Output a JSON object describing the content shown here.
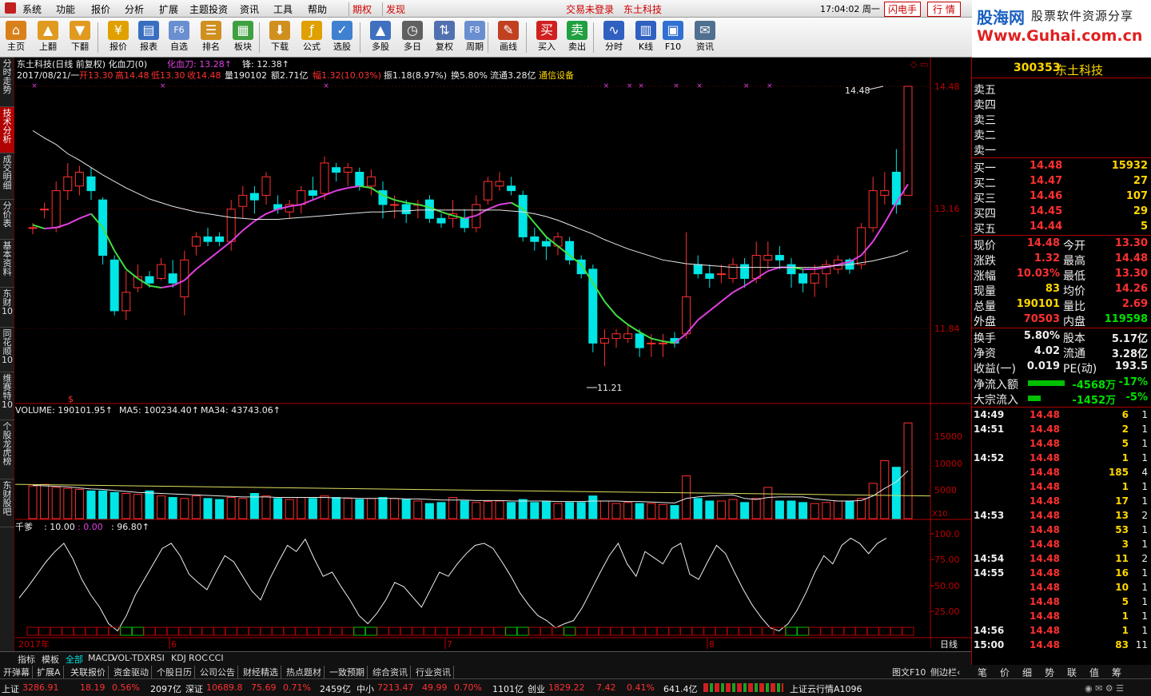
{
  "menu": {
    "items": [
      "系统",
      "功能",
      "报价",
      "分析",
      "扩展",
      "主题投资",
      "资讯",
      "工具",
      "帮助"
    ],
    "tabs": [
      "期权",
      "发现"
    ],
    "login": "交易未登录",
    "stock": "东土科技",
    "time": "17:04:02 周一",
    "buttons": [
      "闪电手",
      "行 情"
    ]
  },
  "logo": {
    "line1": "股海网",
    "line2": "股票软件资源分享",
    "url": "Www.Guhai.com.cn"
  },
  "toolbar": [
    {
      "label": "主页",
      "icon": "home-icon",
      "color": "#d8801a"
    },
    {
      "label": "上翻",
      "icon": "arrow-up-icon",
      "color": "#e09a20"
    },
    {
      "label": "下翻",
      "icon": "arrow-down-icon",
      "color": "#e09a20"
    },
    {
      "label": "报价",
      "icon": "yen-icon",
      "color": "#e0a000"
    },
    {
      "label": "报表",
      "icon": "report-icon",
      "color": "#3a6ec0"
    },
    {
      "label": "自选",
      "icon": "f6-icon",
      "color": "#6a8fd0"
    },
    {
      "label": "排名",
      "icon": "rank-icon",
      "color": "#d09020"
    },
    {
      "label": "板块",
      "icon": "blocks-icon",
      "color": "#40a040"
    },
    {
      "label": "下载",
      "icon": "download-icon",
      "color": "#d09020"
    },
    {
      "label": "公式",
      "icon": "formula-icon",
      "color": "#e0a000"
    },
    {
      "label": "选股",
      "icon": "select-icon",
      "color": "#4080d0"
    },
    {
      "label": "多股",
      "icon": "multi-icon",
      "color": "#4070c0"
    },
    {
      "label": "多日",
      "icon": "clock-icon",
      "color": "#606060"
    },
    {
      "label": "复权",
      "icon": "adjust-icon",
      "color": "#5070b0"
    },
    {
      "label": "周期",
      "icon": "f8-icon",
      "color": "#6a8fd0"
    },
    {
      "label": "画线",
      "icon": "draw-icon",
      "color": "#c04020"
    },
    {
      "label": "买入",
      "icon": "buy-icon",
      "color": "#d02020"
    },
    {
      "label": "卖出",
      "icon": "sell-icon",
      "color": "#20a040"
    },
    {
      "label": "分时",
      "icon": "intraday-icon",
      "color": "#3060c0"
    },
    {
      "label": "K线",
      "icon": "kline-icon",
      "color": "#3060c0"
    },
    {
      "label": "F10",
      "icon": "f10-icon",
      "color": "#3070d0"
    },
    {
      "label": "资讯",
      "icon": "news-icon",
      "color": "#507090"
    }
  ],
  "side_tabs": [
    "分时走势",
    "技术分析",
    "成交明细",
    "分价表",
    "基本资料",
    "东财10",
    "同花顺10",
    "维赛特10",
    "个股龙虎榜",
    "东财股吧"
  ],
  "chart_header": {
    "title": "东土科技(日线 前复权) 化血刀(0)",
    "indicator": "化血刀: 13.28↑",
    "feng": "锋: 12.38↑",
    "info_date": "2017/08/21/一",
    "open": "开13.30",
    "high": "高14.48",
    "low": "低13.30",
    "close": "收14.48",
    "vol": "量190102",
    "amount": "额2.71亿",
    "change": "幅1.32(10.03%)",
    "amp": "振1.18(8.97%)",
    "turnover": "换5.80%",
    "float": "流通3.28亿",
    "sector": "通信设备",
    "max_label": "14.48",
    "min_label": "11.21"
  },
  "price_axis": [
    "14.48",
    "13.16",
    "11.84"
  ],
  "vol_header": {
    "vol": "VOLUME: 190101.95↑",
    "ma5": "MA5: 100234.40↑",
    "ma34": "MA34: 43743.06↑"
  },
  "vol_axis": [
    "15000",
    "10000",
    "5000",
    "X10"
  ],
  "osc_header": {
    "name": "千爹",
    "v1": ": 10.00",
    "v2": ": 0.00",
    "v3": ": 96.80↑"
  },
  "osc_axis": [
    "100.0",
    "75.00",
    "50.00",
    "25.00"
  ],
  "date_axis": {
    "year": "2017年",
    "m6": "6",
    "m7": "7",
    "m8": "8",
    "period": "日线"
  },
  "chart_data": {
    "type": "candlestick",
    "ylim": [
      11.21,
      14.48
    ],
    "candles": [
      [
        12.95,
        12.95,
        13.0,
        12.88
      ],
      [
        13.15,
        13.15,
        13.22,
        13.05
      ],
      [
        12.95,
        13.35,
        13.45,
        12.9
      ],
      [
        13.35,
        13.5,
        13.65,
        13.25
      ],
      [
        13.4,
        13.55,
        13.62,
        13.3
      ],
      [
        13.5,
        13.35,
        13.6,
        13.25
      ],
      [
        13.25,
        12.65,
        13.28,
        12.55
      ],
      [
        12.6,
        12.05,
        12.65,
        12.0
      ],
      [
        12.05,
        12.25,
        12.48,
        11.95
      ],
      [
        12.3,
        12.42,
        12.55,
        12.25
      ],
      [
        12.42,
        12.35,
        12.48,
        12.3
      ],
      [
        12.4,
        12.55,
        12.62,
        12.38
      ],
      [
        12.45,
        12.35,
        12.6,
        12.3
      ],
      [
        12.2,
        12.6,
        12.7,
        12.0
      ],
      [
        12.75,
        12.85,
        12.9,
        12.65
      ],
      [
        12.85,
        12.8,
        12.95,
        12.75
      ],
      [
        12.85,
        12.8,
        12.9,
        12.75
      ],
      [
        12.8,
        13.15,
        13.25,
        12.7
      ],
      [
        13.18,
        13.3,
        13.4,
        13.05
      ],
      [
        13.32,
        13.25,
        13.4,
        13.1
      ],
      [
        13.3,
        13.5,
        13.55,
        13.2
      ],
      [
        13.2,
        13.15,
        13.3,
        13.1
      ],
      [
        13.12,
        13.2,
        13.25,
        13.05
      ],
      [
        13.2,
        13.35,
        13.4,
        13.1
      ],
      [
        13.35,
        13.3,
        13.5,
        13.25
      ],
      [
        13.32,
        13.65,
        13.72,
        13.25
      ],
      [
        13.6,
        13.55,
        13.65,
        13.45
      ],
      [
        13.55,
        13.6,
        13.65,
        13.4
      ],
      [
        13.55,
        13.4,
        13.6,
        13.35
      ],
      [
        13.4,
        13.5,
        13.58,
        13.3
      ],
      [
        13.35,
        13.2,
        13.45,
        13.05
      ],
      [
        13.2,
        13.2,
        13.3,
        13.05
      ],
      [
        13.2,
        13.1,
        13.25,
        13.0
      ],
      [
        13.2,
        13.2,
        13.25,
        13.05
      ],
      [
        13.25,
        13.05,
        13.3,
        13.0
      ],
      [
        13.05,
        13.0,
        13.1,
        12.95
      ],
      [
        13.05,
        13.1,
        13.25,
        12.95
      ],
      [
        13.05,
        12.95,
        13.15,
        12.9
      ],
      [
        12.95,
        13.2,
        13.3,
        12.9
      ],
      [
        13.25,
        13.45,
        13.5,
        13.2
      ],
      [
        13.4,
        13.45,
        13.55,
        13.35
      ],
      [
        13.4,
        13.35,
        13.5,
        13.3
      ],
      [
        13.3,
        12.85,
        13.35,
        12.8
      ],
      [
        12.85,
        12.8,
        12.95,
        12.7
      ],
      [
        12.8,
        12.75,
        12.85,
        12.6
      ],
      [
        12.75,
        12.85,
        12.9,
        12.65
      ],
      [
        12.8,
        12.6,
        12.85,
        12.55
      ],
      [
        12.6,
        12.45,
        12.65,
        12.4
      ],
      [
        12.5,
        11.7,
        12.55,
        11.6
      ],
      [
        11.7,
        11.75,
        11.85,
        11.45
      ],
      [
        11.75,
        11.8,
        11.85,
        11.65
      ],
      [
        11.75,
        11.8,
        11.9,
        11.7
      ],
      [
        11.8,
        11.65,
        11.85,
        11.55
      ],
      [
        11.7,
        11.7,
        11.8,
        11.55
      ],
      [
        11.7,
        11.7,
        11.8,
        11.55
      ],
      [
        11.75,
        11.7,
        11.82,
        11.65
      ],
      [
        11.8,
        12.2,
        12.9,
        11.75
      ],
      [
        12.55,
        12.45,
        12.65,
        12.4
      ],
      [
        12.45,
        12.4,
        12.55,
        12.3
      ],
      [
        12.45,
        12.45,
        12.55,
        12.35
      ],
      [
        12.4,
        12.55,
        12.62,
        12.35
      ],
      [
        12.55,
        12.4,
        12.62,
        12.3
      ],
      [
        12.4,
        12.65,
        12.8,
        12.35
      ],
      [
        12.6,
        12.65,
        12.8,
        12.5
      ],
      [
        12.65,
        12.6,
        12.75,
        12.5
      ],
      [
        12.55,
        12.45,
        12.62,
        12.3
      ],
      [
        12.45,
        12.35,
        12.5,
        12.25
      ],
      [
        12.35,
        12.45,
        12.55,
        12.2
      ],
      [
        12.45,
        12.55,
        12.6,
        12.3
      ],
      [
        12.5,
        12.6,
        12.65,
        12.45
      ],
      [
        12.6,
        12.5,
        12.62,
        12.45
      ],
      [
        12.55,
        12.95,
        13.0,
        12.5
      ],
      [
        12.95,
        13.35,
        13.5,
        12.9
      ],
      [
        13.3,
        13.35,
        13.55,
        13.2
      ],
      [
        13.55,
        13.2,
        13.8,
        13.1
      ],
      [
        13.3,
        14.48,
        14.48,
        13.3
      ]
    ],
    "ma_fast": [
      12.98,
      12.94,
      12.95,
      12.99,
      13.05,
      13.1,
      12.95,
      12.7,
      12.5,
      12.4,
      12.32,
      12.3,
      12.32,
      12.38,
      12.5,
      12.6,
      12.7,
      12.8,
      12.92,
      13.02,
      13.1,
      13.15,
      13.18,
      13.2,
      13.25,
      13.3,
      13.35,
      13.38,
      13.4,
      13.38,
      13.3,
      13.25,
      13.22,
      13.2,
      13.17,
      13.12,
      13.08,
      13.05,
      13.08,
      13.15,
      13.2,
      13.22,
      13.15,
      13.0,
      12.85,
      12.75,
      12.65,
      12.55,
      12.35,
      12.15,
      12.0,
      11.9,
      11.82,
      11.75,
      11.72,
      11.7,
      11.8,
      11.95,
      12.05,
      12.15,
      12.25,
      12.32,
      12.4,
      12.48,
      12.52,
      12.52,
      12.5,
      12.5,
      12.52,
      12.55,
      12.58,
      12.65,
      12.8,
      13.0,
      13.22,
      13.42
    ],
    "ma_slow": [
      14.0,
      13.92,
      13.85,
      13.75,
      13.68,
      13.6,
      13.52,
      13.45,
      13.38,
      13.32,
      13.26,
      13.22,
      13.18,
      13.15,
      13.12,
      13.1,
      13.08,
      13.06,
      13.05,
      13.04,
      13.04,
      13.04,
      13.05,
      13.06,
      13.07,
      13.08,
      13.09,
      13.1,
      13.11,
      13.12,
      13.12,
      13.13,
      13.13,
      13.14,
      13.14,
      13.14,
      13.14,
      13.14,
      13.14,
      13.14,
      13.14,
      13.13,
      13.12,
      13.1,
      13.07,
      13.03,
      12.98,
      12.93,
      12.88,
      12.82,
      12.77,
      12.72,
      12.68,
      12.64,
      12.6,
      12.58,
      12.56,
      12.55,
      12.54,
      12.53,
      12.52,
      12.52,
      12.52,
      12.52,
      12.52,
      12.52,
      12.52,
      12.52,
      12.53,
      12.54,
      12.55,
      12.57,
      12.59,
      12.62,
      12.65,
      12.7
    ],
    "volumes": [
      6.5,
      6.8,
      6.2,
      6.0,
      5.8,
      5.5,
      5.5,
      5.2,
      5.0,
      4.8,
      5.5,
      4.5,
      4.2,
      4.0,
      4.5,
      4.0,
      3.8,
      4.2,
      4.0,
      5.0,
      4.5,
      4.0,
      3.8,
      4.2,
      4.0,
      4.5,
      4.2,
      4.0,
      3.8,
      4.0,
      4.2,
      4.0,
      3.8,
      3.5,
      3.0,
      3.2,
      4.2,
      3.5,
      3.2,
      3.4,
      3.5,
      3.2,
      3.8,
      3.2,
      3.4,
      3.0,
      3.2,
      3.2,
      4.5,
      3.5,
      3.0,
      3.2,
      3.0,
      3.0,
      2.8,
      2.6,
      8.5,
      4.0,
      3.5,
      3.5,
      3.8,
      3.2,
      4.0,
      6.2,
      3.5,
      3.5,
      3.2,
      3.0,
      3.2,
      3.5,
      3.5,
      4.0,
      7.0,
      11.5,
      10.2,
      19.0
    ],
    "vol_ma5": [
      6.6,
      6.5,
      6.4,
      6.3,
      6.1,
      5.9,
      5.8,
      5.6,
      5.4,
      5.2,
      5.1,
      5.0,
      4.9,
      4.8,
      4.7,
      4.6,
      4.5,
      4.4,
      4.3,
      4.3,
      4.3,
      4.2,
      4.2,
      4.2,
      4.2,
      4.2,
      4.1,
      4.1,
      4.0,
      4.0,
      4.0,
      4.0,
      3.9,
      3.9,
      3.8,
      3.7,
      3.7,
      3.7,
      3.6,
      3.6,
      3.6,
      3.5,
      3.5,
      3.5,
      3.5,
      3.4,
      3.4,
      3.4,
      3.5,
      3.5,
      3.5,
      3.4,
      3.4,
      3.3,
      3.2,
      3.1,
      4.0,
      4.3,
      4.5,
      4.6,
      4.7,
      4.0,
      3.8,
      4.2,
      4.3,
      4.3,
      4.3,
      3.9,
      3.7,
      3.5,
      3.5,
      3.6,
      4.5,
      6.0,
      7.3,
      9.5
    ],
    "oscillator": [
      37,
      48,
      60,
      72,
      82,
      90,
      75,
      55,
      40,
      28,
      12,
      5,
      20,
      40,
      55,
      70,
      85,
      90,
      78,
      60,
      52,
      45,
      62,
      78,
      72,
      58,
      44,
      35,
      55,
      72,
      88,
      82,
      94,
      75,
      58,
      62,
      48,
      35,
      20,
      12,
      22,
      35,
      52,
      48,
      38,
      28,
      45,
      62,
      58,
      70,
      80,
      88,
      90,
      85,
      72,
      58,
      42,
      30,
      20,
      15,
      8,
      12,
      15,
      28,
      45,
      62,
      78,
      90,
      70,
      58,
      82,
      76,
      70,
      85,
      90,
      60,
      55,
      72,
      88,
      80,
      62,
      45,
      30,
      18,
      8,
      5,
      12,
      25,
      42,
      62,
      78,
      70,
      88,
      95,
      90,
      80,
      90,
      95
    ]
  },
  "rpanel": {
    "code": "300353",
    "name": "东土科技",
    "sell": [
      {
        "l": "卖五"
      },
      {
        "l": "卖四"
      },
      {
        "l": "卖三"
      },
      {
        "l": "卖二"
      },
      {
        "l": "卖一"
      }
    ],
    "buy": [
      {
        "l": "买一",
        "p": "14.48",
        "v": "15932"
      },
      {
        "l": "买二",
        "p": "14.47",
        "v": "27"
      },
      {
        "l": "买三",
        "p": "14.46",
        "v": "107"
      },
      {
        "l": "买四",
        "p": "14.45",
        "v": "29"
      },
      {
        "l": "买五",
        "p": "14.44",
        "v": "5"
      }
    ],
    "stats": [
      {
        "a": "现价",
        "av": "14.48",
        "b": "今开",
        "bv": "13.30",
        "ac": "red",
        "bc": "red"
      },
      {
        "a": "涨跌",
        "av": "1.32",
        "b": "最高",
        "bv": "14.48",
        "ac": "red",
        "bc": "red"
      },
      {
        "a": "涨幅",
        "av": "10.03%",
        "b": "最低",
        "bv": "13.30",
        "ac": "red",
        "bc": "red"
      },
      {
        "a": "现量",
        "av": "83",
        "b": "均价",
        "bv": "14.26",
        "ac": "yellow",
        "bc": "red"
      },
      {
        "a": "总量",
        "av": "190101",
        "b": "量比",
        "bv": "2.69",
        "ac": "yellow",
        "bc": "red"
      },
      {
        "a": "外盘",
        "av": "70503",
        "b": "内盘",
        "bv": "119598",
        "ac": "red",
        "bc": "green"
      }
    ],
    "stats2": [
      {
        "a": "换手",
        "av": "5.80%",
        "b": "股本",
        "bv": "5.17亿"
      },
      {
        "a": "净资",
        "av": "4.02",
        "b": "流通",
        "bv": "3.28亿"
      },
      {
        "a": "收益(一)",
        "av": "0.019",
        "b": "PE(动)",
        "bv": "193.5"
      }
    ],
    "flows": [
      {
        "l": "净流入额",
        "v": "-4568万",
        "p": "-17%"
      },
      {
        "l": "大宗流入",
        "v": "-1452万",
        "p": "-5%"
      }
    ],
    "ticks": [
      {
        "t": "14:49",
        "p": "14.48",
        "v": "6",
        "n": "1"
      },
      {
        "t": "14:51",
        "p": "14.48",
        "v": "2",
        "n": "1"
      },
      {
        "t": "",
        "p": "14.48",
        "v": "5",
        "n": "1"
      },
      {
        "t": "14:52",
        "p": "14.48",
        "v": "1",
        "n": "1"
      },
      {
        "t": "",
        "p": "14.48",
        "v": "185",
        "n": "4"
      },
      {
        "t": "",
        "p": "14.48",
        "v": "1",
        "n": "1"
      },
      {
        "t": "",
        "p": "14.48",
        "v": "17",
        "n": "1"
      },
      {
        "t": "14:53",
        "p": "14.48",
        "v": "13",
        "n": "2"
      },
      {
        "t": "",
        "p": "14.48",
        "v": "53",
        "n": "1"
      },
      {
        "t": "",
        "p": "14.48",
        "v": "3",
        "n": "1"
      },
      {
        "t": "14:54",
        "p": "14.48",
        "v": "11",
        "n": "2"
      },
      {
        "t": "14:55",
        "p": "14.48",
        "v": "16",
        "n": "1"
      },
      {
        "t": "",
        "p": "14.48",
        "v": "10",
        "n": "1"
      },
      {
        "t": "",
        "p": "14.48",
        "v": "5",
        "n": "1"
      },
      {
        "t": "",
        "p": "14.48",
        "v": "1",
        "n": "1"
      },
      {
        "t": "14:56",
        "p": "14.48",
        "v": "1",
        "n": "1"
      },
      {
        "t": "15:00",
        "p": "14.48",
        "v": "83",
        "n": "11"
      }
    ],
    "bottom_tabs": [
      "笔",
      "价",
      "细",
      "势",
      "联",
      "值",
      "筹"
    ]
  },
  "indicator_tabs": [
    "指标",
    "模板",
    "全部",
    "MACD",
    "VOL-TDX",
    "RSI",
    "KDJ",
    "ROC",
    "CCI"
  ],
  "bottom_tabs": [
    "开弹幕",
    "扩展A",
    "关联报价",
    "资金驱动",
    "个股日历",
    "公司公告",
    "财经精选",
    "热点题材",
    "一致预期",
    "综合资讯",
    "行业资讯"
  ],
  "bottom_right": [
    "图文F10",
    "侧边栏‹"
  ],
  "status": {
    "sh_label": "上证",
    "sh": "3286.91",
    "sh_ch": "18.19",
    "sh_pct": "0.56%",
    "sh_amt": "2097亿",
    "sz_label": "深证",
    "sz": "10689.8",
    "sz_ch": "75.69",
    "sz_pct": "0.71%",
    "sz_amt": "2459亿",
    "zx_label": "中小",
    "zx": "7213.47",
    "zx_ch": "49.99",
    "zx_pct": "0.70%",
    "zx_amt": "1101亿",
    "cy_label": "创业",
    "cy": "1829.22",
    "cy_ch": "7.42",
    "cy_pct": "0.41%",
    "cy_amt": "641.4亿",
    "cloud": "上证云行情A1096"
  }
}
